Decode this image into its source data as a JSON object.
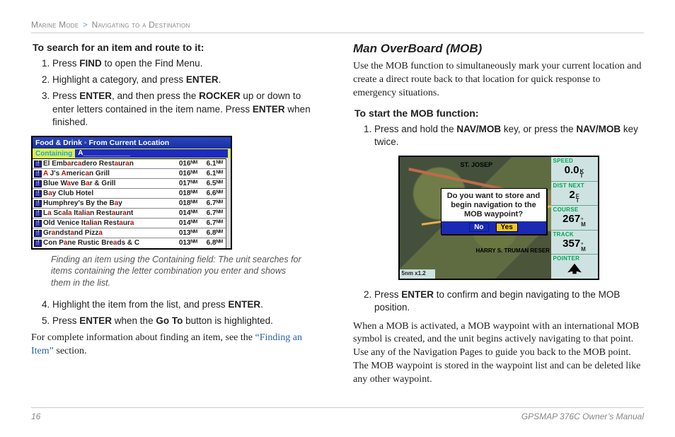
{
  "breadcrumb": {
    "left": "Marine Mode",
    "right": "Navigating to a Destination"
  },
  "left": {
    "heading": "To search for an item and route to it:",
    "steps_a": [
      "Press <b>FIND</b> to open the Find Menu.",
      "Highlight a category, and press <b>ENTER</b>.",
      "Press <b>ENTER</b>, and then press the <b>ROCKER</b> up or down to enter letters contained in the item name. Press <b>ENTER</b> when finished."
    ],
    "device1": {
      "title": "Food & Drink ◦ From Current Location",
      "search_label": "Containing",
      "search_value": "A____________",
      "rows": [
        {
          "name": "El Emb<r>a</r>rc<r>a</r>dero Rest<r>a</r>ur<r>a</r>n",
          "c1": "016ᴺᴹ",
          "c2": "6.1ᴺᴹ"
        },
        {
          "name": "<r>A</r> J's <r>A</r>meric<r>a</r>n Grill",
          "c1": "016ᴺᴹ",
          "c2": "6.1ᴺᴹ"
        },
        {
          "name": "Blue W<r>a</r>ve B<r>a</r>r & Grill",
          "c1": "017ᴺᴹ",
          "c2": "6.5ᴺᴹ"
        },
        {
          "name": "B<r>a</r>y Club Hotel",
          "c1": "018ᴺᴹ",
          "c2": "6.6ᴺᴹ"
        },
        {
          "name": "Humphrey's By the B<r>a</r>y",
          "c1": "018ᴺᴹ",
          "c2": "6.7ᴺᴹ"
        },
        {
          "name": "L<r>a</r> Sc<r>a</r>l<r>a</r> It<r>a</r>li<r>a</r>n Rest<r>a</r>ur<r>a</r>nt",
          "c1": "014ᴺᴹ",
          "c2": "6.7ᴺᴹ"
        },
        {
          "name": "Old Venice It<r>a</r>li<r>a</r>n Rest<r>a</r>ur<r>a</r>",
          "c1": "014ᴺᴹ",
          "c2": "6.7ᴺᴹ"
        },
        {
          "name": "Gr<r>a</r>ndst<r>a</r>nd Pizz<r>a</r>",
          "c1": "013ᴺᴹ",
          "c2": "6.8ᴺᴹ"
        },
        {
          "name": "Con P<r>a</r>ne Rustic Bre<r>a</r>ds & C",
          "c1": "013ᴺᴹ",
          "c2": "6.8ᴺᴹ"
        }
      ]
    },
    "caption": "Finding an item using the Containing field: The unit searches for items containing the letter combination you enter and shows them in the list.",
    "steps_b": [
      "Highlight the item from the list, and press <b>ENTER</b>.",
      "Press <b>ENTER</b> when the <b>Go To</b> button is highlighted."
    ],
    "tail_text": "For complete information about finding an item, see the ",
    "tail_link": "“Finding an Item”",
    "tail_after": " section."
  },
  "right": {
    "title": "Man OverBoard (MOB)",
    "intro": "Use the MOB function to simultaneously mark your current location and create a direct route back to that location for quick response to emergency situations.",
    "subhead": "To start the MOB function:",
    "step1": "Press and hold the <b>NAV/MOB</b> key, or press the <b>NAV/MOB</b> key twice.",
    "device2": {
      "city1": "ST. JOSEP",
      "city2": "HARRY S. TRUMAN RESER",
      "dialog_text": "Do you want to store and begin navigation to the MOB waypoint?",
      "btn_no": "No",
      "btn_yes": "Yes",
      "bottom": "5nm   x1.2",
      "panels": [
        {
          "label": "SPEED",
          "value": "0.0",
          "unit": "K\nT"
        },
        {
          "label": "DIST NEXT",
          "value": "2",
          "unit": "F\nT"
        },
        {
          "label": "COURSE",
          "value": "267",
          "unit": "°\nM"
        },
        {
          "label": "TRACK",
          "value": "357",
          "unit": "°\nM"
        },
        {
          "label": "POINTER",
          "value": "",
          "unit": ""
        }
      ]
    },
    "step2": "Press <b>ENTER</b> to confirm and begin navigating to the MOB position.",
    "body": "When a MOB is activated, a MOB waypoint with an international MOB symbol is created, and the unit begins actively navigating to that point. Use any of the Navigation Pages to guide you back to the MOB point. The MOB waypoint is stored in the waypoint list and can be deleted like any other waypoint."
  },
  "footer": {
    "page": "16",
    "manual": "GPSMAP 376C Owner’s Manual"
  }
}
